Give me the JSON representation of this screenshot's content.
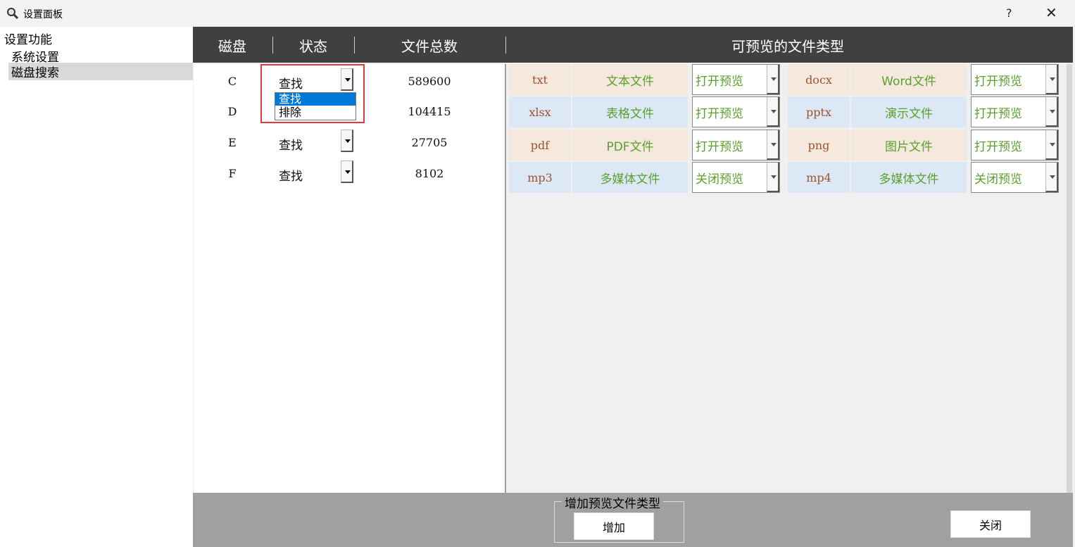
{
  "window": {
    "title": "设置面板",
    "help": "?",
    "close": "✕"
  },
  "tree": {
    "root": "设置功能",
    "items": [
      "系统设置",
      "磁盘搜索"
    ]
  },
  "disk_table": {
    "headers": [
      "磁盘",
      "状态",
      "文件总数"
    ],
    "rows": [
      {
        "disk": "C",
        "status": "查找",
        "count": "589600"
      },
      {
        "disk": "D",
        "status": "查找",
        "count": "104415"
      },
      {
        "disk": "E",
        "status": "查找",
        "count": "27705"
      },
      {
        "disk": "F",
        "status": "查找",
        "count": "8102"
      }
    ],
    "dropdown_options": [
      "查找",
      "排除"
    ],
    "dropdown_selected": "查找"
  },
  "preview": {
    "header": "可预览的文件类型",
    "rows": [
      {
        "left": {
          "ext": "txt",
          "name": "文本文件",
          "state": "打开预览"
        },
        "right": {
          "ext": "docx",
          "name": "Word文件",
          "state": "打开预览"
        },
        "color": "peach"
      },
      {
        "left": {
          "ext": "xlsx",
          "name": "表格文件",
          "state": "打开预览"
        },
        "right": {
          "ext": "pptx",
          "name": "演示文件",
          "state": "打开预览"
        },
        "color": "blue"
      },
      {
        "left": {
          "ext": "pdf",
          "name": "PDF文件",
          "state": "打开预览"
        },
        "right": {
          "ext": "png",
          "name": "图片文件",
          "state": "打开预览"
        },
        "color": "peach"
      },
      {
        "left": {
          "ext": "mp3",
          "name": "多媒体文件",
          "state": "关闭预览"
        },
        "right": {
          "ext": "mp4",
          "name": "多媒体文件",
          "state": "关闭预览"
        },
        "color": "blue"
      }
    ]
  },
  "bottom": {
    "group_label": "增加预览文件类型",
    "add_button": "增加",
    "close_button": "关闭"
  },
  "colors": {
    "header_bg": "#404040",
    "peach": "#f5e8dc",
    "blue": "#dce8f5",
    "text_green": "#5aa02c",
    "ext_brown": "#a0522d",
    "highlight_red": "#e03a3a",
    "selection_blue": "#0078d7"
  }
}
